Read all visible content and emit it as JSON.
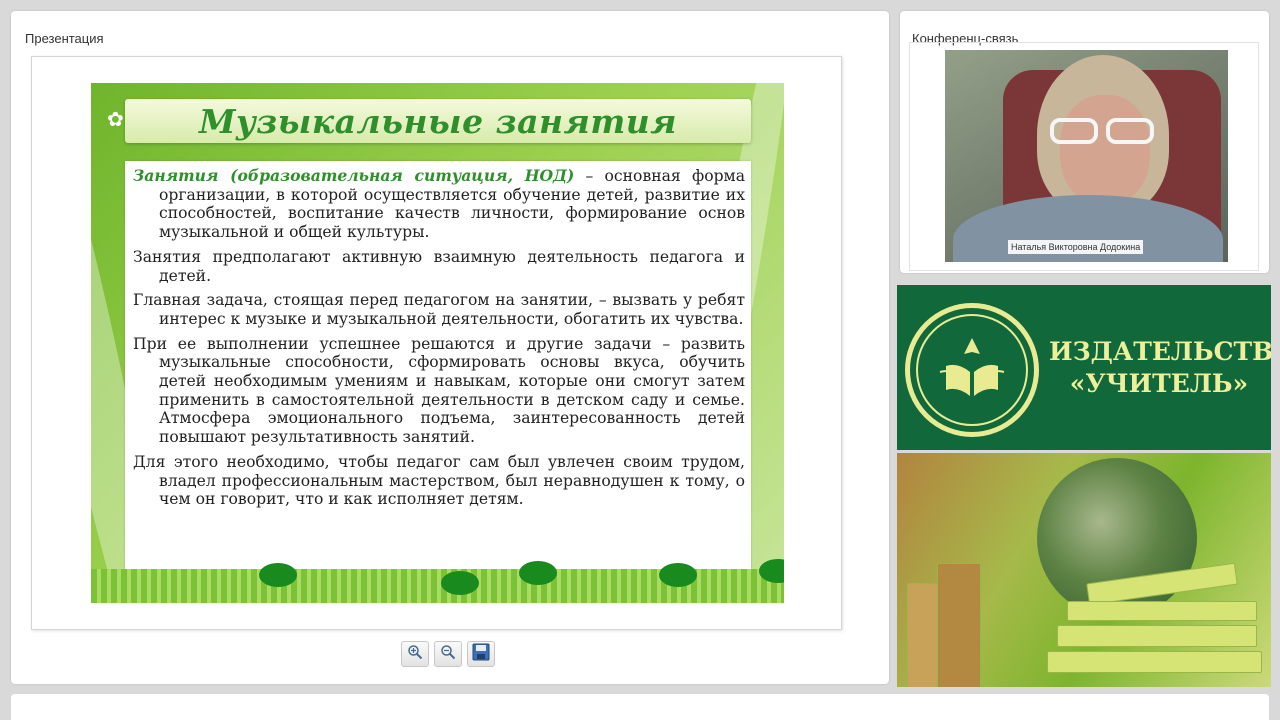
{
  "presentation": {
    "panel_title": "Презентация",
    "slide": {
      "title": "Музыкальные занятия",
      "paragraphs": [
        {
          "highlight": "Занятия (образовательная ситуация, НОД)",
          "text": " – основная форма организации, в которой осуществляется обучение детей, развитие их способностей, воспитание качеств личности, формирование основ музыкальной и общей культуры."
        },
        {
          "text": "Занятия предполагают активную взаимную деятельность педагога и детей."
        },
        {
          "text": "Главная задача, стоящая перед педагогом на занятии, – вызвать у ребят интерес к музыке и музыкальной деятельности, обогатить их чувства."
        },
        {
          "text": "При ее выполнении успешнее решаются и другие задачи – развить музыкальные способности, сформировать основы вкуса, обучить детей необходимым умениям и навыкам, которые они смогут затем применить в самостоятельной деятельности в детском саду и семье. Атмосфера эмоционального подъема, заинтересованность детей повышают результативность занятий."
        },
        {
          "text": "Для этого необходимо, чтобы педагог сам был увлечен своим трудом, владел профессиональным мастерством, был неравнодушен к тому, о чем он говорит, что и как исполняет детям."
        }
      ]
    },
    "controls": {
      "zoom_in_icon": "magnifier-plus-icon",
      "zoom_out_icon": "magnifier-minus-icon",
      "save_icon": "floppy-disk-icon"
    }
  },
  "conference": {
    "panel_title": "Конференц-связь",
    "speaker_name": "Наталья Викторовна Додокина"
  },
  "publisher": {
    "line1": "ИЗДАТЕЛЬСТВО",
    "line2": "«УЧИТЕЛЬ»"
  },
  "colors": {
    "brand_green": "#11693b",
    "brand_yellow": "#eeef9b",
    "slide_accent": "#2f8f2a"
  }
}
